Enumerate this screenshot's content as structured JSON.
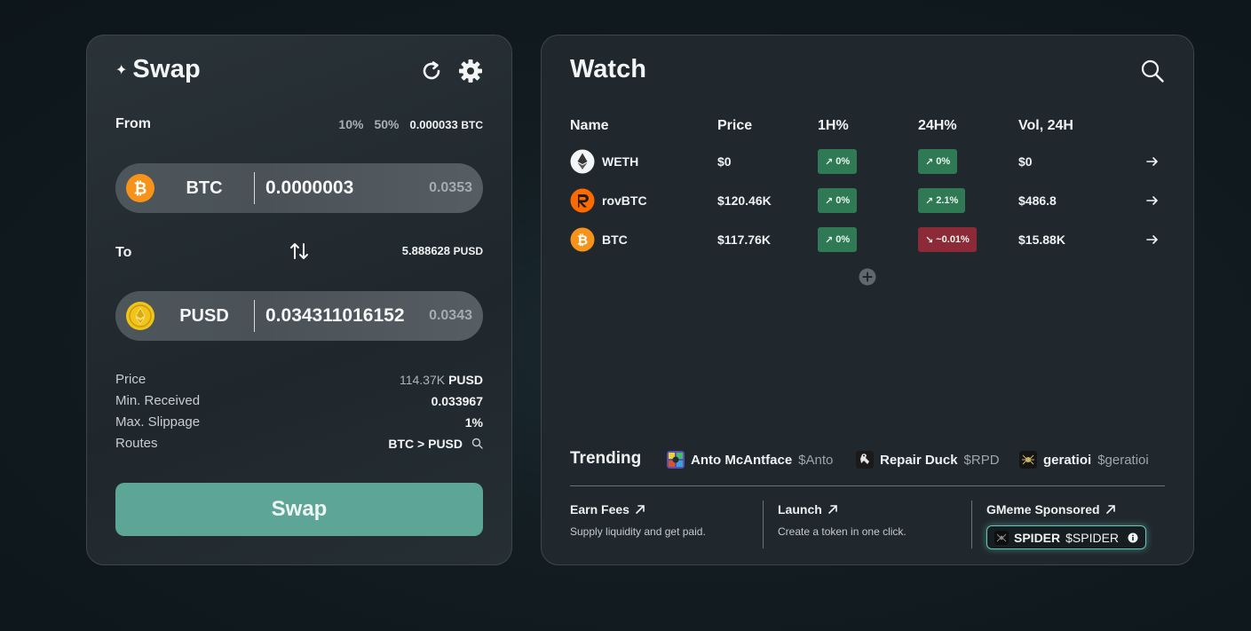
{
  "swap": {
    "title": "Swap",
    "sparkle": "✦",
    "from_label": "From",
    "percent_options": [
      "10%",
      "50%"
    ],
    "from_balance": "0.000033",
    "from_balance_unit": "BTC",
    "from_token": {
      "symbol": "BTC",
      "amount": "0.0000003",
      "usd": "0.0353",
      "icon": "bitcoin-icon"
    },
    "to_label": "To",
    "to_balance": "5.888628",
    "to_balance_unit": "PUSD",
    "to_token": {
      "symbol": "PUSD",
      "amount": "0.034311016152",
      "usd": "0.0343",
      "icon": "pusd-icon"
    },
    "info": {
      "price_label": "Price",
      "price_value": "114.37K",
      "price_unit": "PUSD",
      "min_received_label": "Min. Received",
      "min_received_value": "0.033967",
      "slippage_label": "Max. Slippage",
      "slippage_value": "1%",
      "routes_label": "Routes",
      "routes_value": "BTC > PUSD"
    },
    "button_label": "Swap"
  },
  "watch": {
    "title": "Watch",
    "columns": [
      "Name",
      "Price",
      "1H%",
      "24H%",
      "Vol, 24H"
    ],
    "rows": [
      {
        "name": "WETH",
        "price": "$0",
        "h1": "0%",
        "h1_dir": "up",
        "h24": "0%",
        "h24_dir": "up",
        "vol": "$0",
        "icon": "ethereum-icon"
      },
      {
        "name": "rovBTC",
        "price": "$120.46K",
        "h1": "0%",
        "h1_dir": "up",
        "h24": "2.1%",
        "h24_dir": "up",
        "vol": "$486.8",
        "icon": "rovbtc-icon"
      },
      {
        "name": "BTC",
        "price": "$117.76K",
        "h1": "0%",
        "h1_dir": "up",
        "h24": "~0.01%",
        "h24_dir": "down",
        "vol": "$15.88K",
        "icon": "bitcoin-icon"
      }
    ],
    "trending_label": "Trending",
    "trending": [
      {
        "name": "Anto McAntface",
        "symbol": "$Anto"
      },
      {
        "name": "Repair Duck",
        "symbol": "$RPD"
      },
      {
        "name": "geratioi",
        "symbol": "$geratioi"
      }
    ],
    "promos": [
      {
        "title": "Earn Fees",
        "desc": "Supply liquidity and get paid."
      },
      {
        "title": "Launch",
        "desc": "Create a token in one click."
      },
      {
        "title": "GMeme Sponsored",
        "desc": ""
      }
    ],
    "sponsor": {
      "name": "SPIDER",
      "symbol": "$SPIDER"
    }
  },
  "colors": {
    "accent": "#5da596",
    "up": "#2f7a55",
    "down": "#8c2b37",
    "bitcoin": "#f7931a",
    "rovbtc": "#ff6a00",
    "pusd": "#f0c419"
  }
}
